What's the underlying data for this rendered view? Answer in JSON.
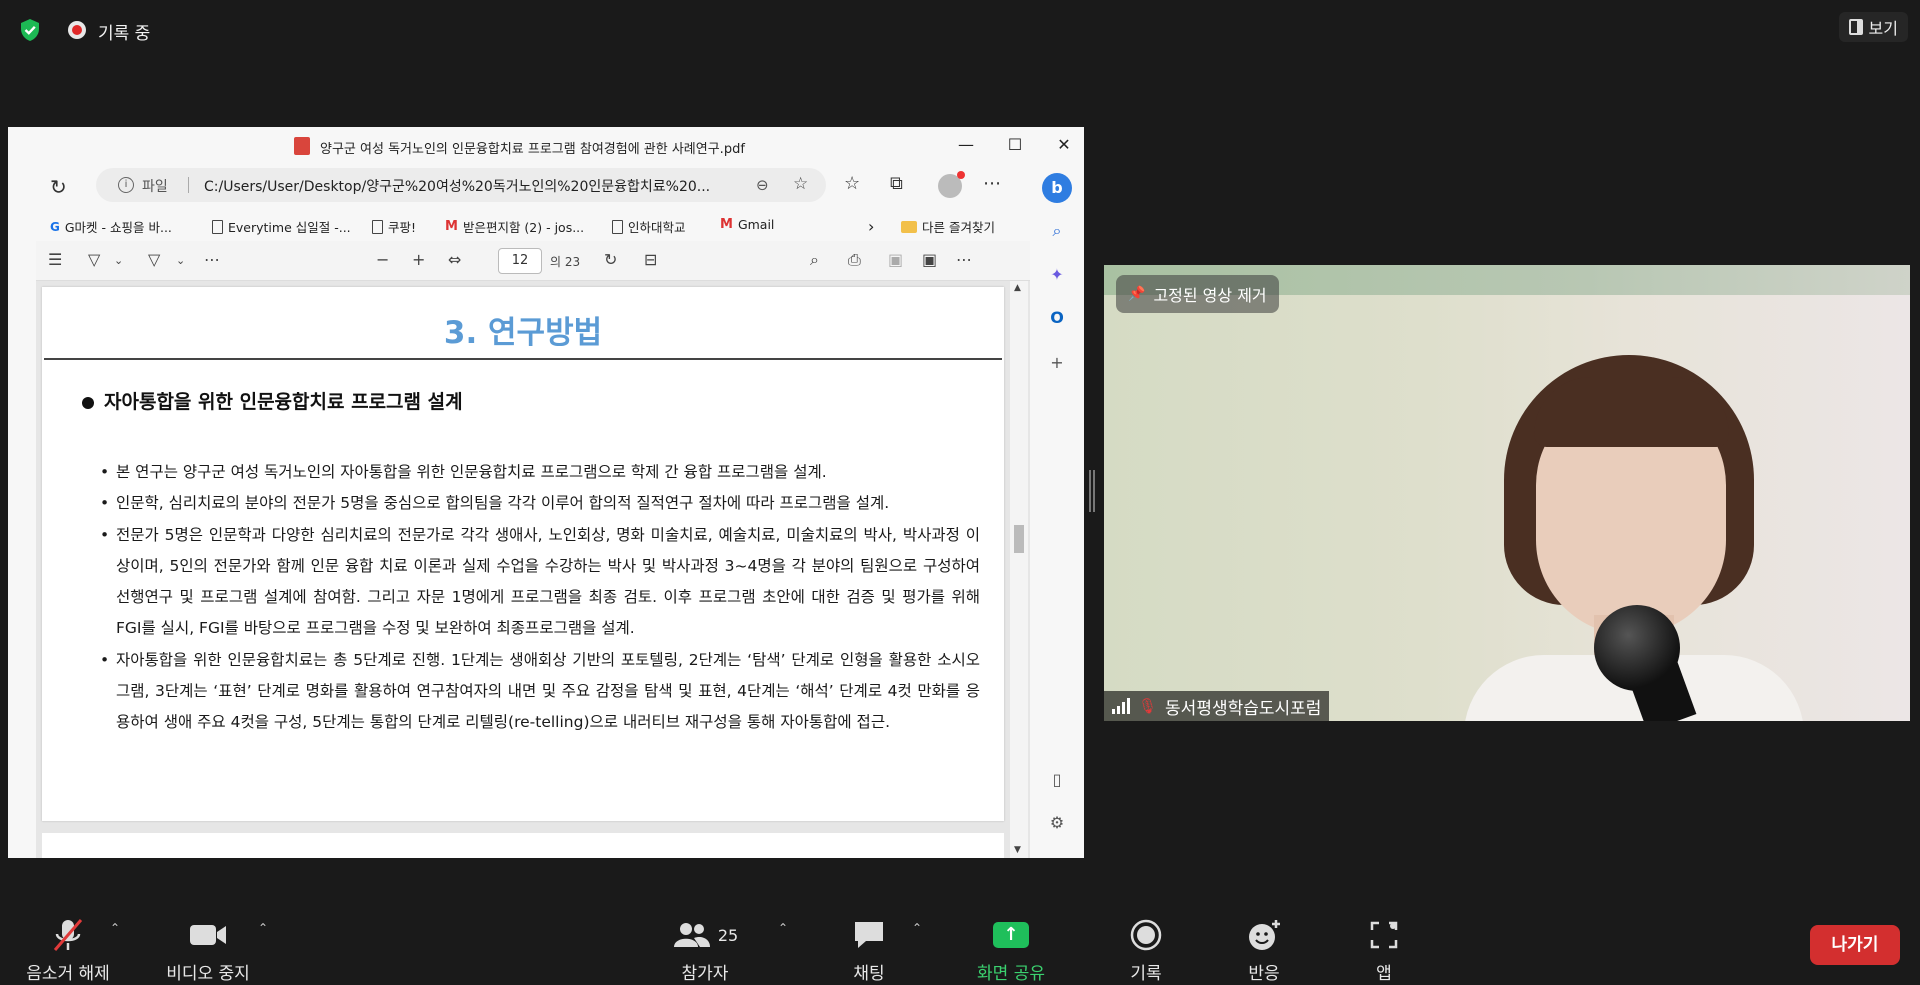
{
  "zoom": {
    "recording_label": "기록 중",
    "view_label": "보기",
    "pin_remove_label": "고정된 영상 제거",
    "participant_name": "동서평생학습도시포럼",
    "controls": {
      "unmute": "음소거 해제",
      "stop_video": "비디오 중지",
      "participants": "참가자",
      "participant_count": "25",
      "chat": "채팅",
      "share_screen": "화면 공유",
      "record": "기록",
      "reactions": "반응",
      "apps": "앱",
      "leave": "나가기"
    },
    "colors": {
      "share_green": "#1fbf5b",
      "leave_red": "#d32f2f",
      "shield_green": "#1db954"
    }
  },
  "browser": {
    "window_title": "양구군 여성 독거노인의 인문융합치료 프로그램 참여경험에 관한 사례연구.pdf",
    "address_label": "파일",
    "address_url": "C:/Users/User/Desktop/양구군%20여성%20독거노인의%20인문융합치료%20...",
    "favorites": [
      {
        "label": "G마켓 - 쇼핑을 바...",
        "icon": "gmarket-icon"
      },
      {
        "label": "Everytime 십일절 -...",
        "icon": "page-icon"
      },
      {
        "label": "쿠팡!",
        "icon": "page-icon"
      },
      {
        "label": "받은편지함 (2) - jos...",
        "icon": "gmail-icon"
      },
      {
        "label": "인하대학교",
        "icon": "page-icon"
      },
      {
        "label": "Gmail",
        "icon": "gmail-icon"
      }
    ],
    "other_favorites": "다른 즐겨찾기",
    "pdf": {
      "current_page": "12",
      "total_pages": "의 23",
      "section_title": "3. 연구방법",
      "heading": "자아통합을 위한 인문융합치료 프로그램  설계",
      "bullets": [
        "본 연구는 양구군 여성 독거노인의 자아통합을 위한 인문융합치료 프로그램으로 학제 간 융합 프로그램을 설계.",
        "인문학, 심리치료의 분야의 전문가 5명을 중심으로 합의팀을 각각 이루어 합의적 질적연구 절차에 따라 프로그램을 설계.",
        "전문가 5명은 인문학과 다양한 심리치료의 전문가로 각각 생애사, 노인회상, 명화 미술치료, 예술치료, 미술치료의 박사, 박사과정 이상이며, 5인의 전문가와 함께 인문 융합 치료 이론과 실제 수업을 수강하는 박사 및 박사과정 3~4명을 각 분야의 팀원으로 구성하여 선행연구 및 프로그램 설계에 참여함. 그리고 자문 1명에게 프로그램을 최종 검토. 이후 프로그램 초안에 대한 검증 및 평가를 위해 FGI를 실시, FGI를 바탕으로 프로그램을 수정 및 보완하여 최종프로그램을 설계.",
        "자아통합을 위한 인문융합치료는  총 5단계로 진행. 1단계는 생애회상 기반의 포토텔링, 2단계는 ‘탐색’ 단계로 인형을 활용한 소시오그램, 3단계는 ‘표현’ 단계로 명화를 활용하여 연구참여자의 내면 및 주요 감정을 탐색 및 표현, 4단계는 ‘해석’ 단계로 4컷 만화를 응용하여 생애 주요 4컷을 구성, 5단계는 통합의 단계로 리텔링(re-telling)으로 내러티브 재구성을 통해 자아통합에 접근."
      ]
    }
  }
}
